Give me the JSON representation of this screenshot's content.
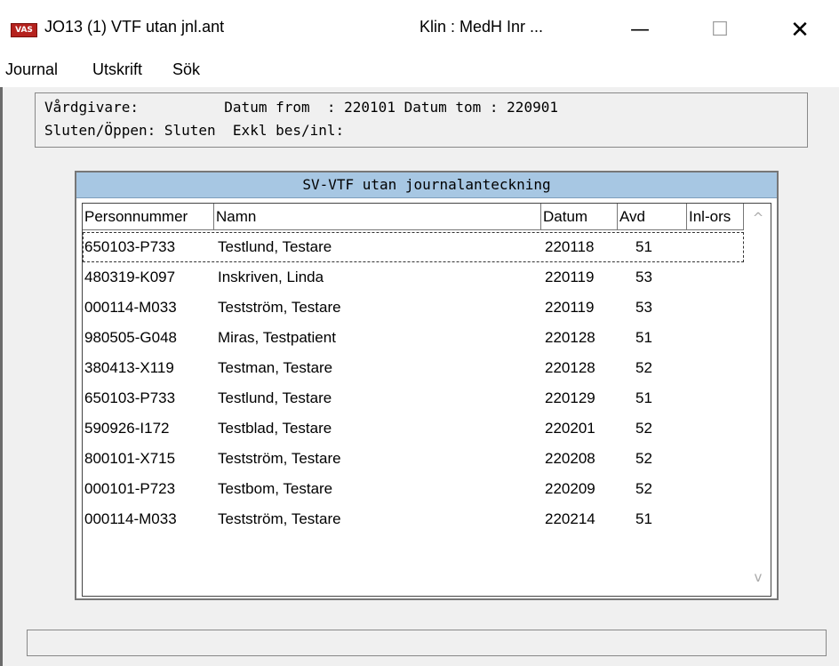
{
  "window": {
    "app_icon_label": "VAS",
    "title": "JO13 (1) VTF utan jnl.ant",
    "title_extra": "Klin : MedH  Inr ...",
    "minimize": "—",
    "maximize": "☐",
    "close": "✕"
  },
  "menu": {
    "items": [
      "Journal",
      "Utskrift",
      "Sök"
    ]
  },
  "info": {
    "line1": "Vårdgivare:          Datum from  : 220101 Datum tom : 220901",
    "line2": "Sluten/Öppen: Sluten  Exkl bes/inl:"
  },
  "list": {
    "title": "SV-VTF utan journalanteckning",
    "columns": [
      "Personnummer",
      "Namn",
      "Datum",
      "Avd",
      "Inl-ors"
    ],
    "rows": [
      [
        "650103-P733",
        "Testlund, Testare",
        "220118",
        "51"
      ],
      [
        "480319-K097",
        "Inskriven, Linda",
        "220119",
        "53"
      ],
      [
        "000114-M033",
        "Testström, Testare",
        "220119",
        "53"
      ],
      [
        "980505-G048",
        "Miras, Testpatient",
        "220128",
        "51"
      ],
      [
        "380413-X119",
        "Testman, Testare",
        "220128",
        "52"
      ],
      [
        "650103-P733",
        "Testlund, Testare",
        "220129",
        "51"
      ],
      [
        "590926-I172",
        "Testblad, Testare",
        "220201",
        "52"
      ],
      [
        "800101-X715",
        "Testström, Testare",
        "220208",
        "52"
      ],
      [
        "000101-P723",
        "Testbom, Testare",
        "220209",
        "52"
      ],
      [
        "000114-M033",
        "Testström, Testare",
        "220214",
        "51"
      ]
    ],
    "scroll_up": "^",
    "scroll_down": "v"
  },
  "status": {
    "text": ""
  }
}
